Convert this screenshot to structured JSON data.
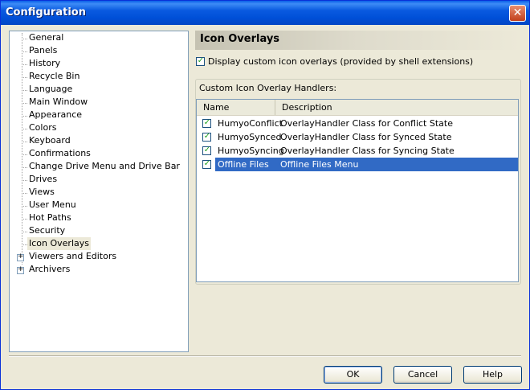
{
  "window": {
    "title": "Configuration"
  },
  "tree": {
    "items": [
      {
        "label": "General"
      },
      {
        "label": "Panels"
      },
      {
        "label": "History"
      },
      {
        "label": "Recycle Bin"
      },
      {
        "label": "Language"
      },
      {
        "label": "Main Window"
      },
      {
        "label": "Appearance"
      },
      {
        "label": "Colors"
      },
      {
        "label": "Keyboard"
      },
      {
        "label": "Confirmations"
      },
      {
        "label": "Change Drive Menu and Drive Bar"
      },
      {
        "label": "Drives"
      },
      {
        "label": "Views"
      },
      {
        "label": "User Menu"
      },
      {
        "label": "Hot Paths"
      },
      {
        "label": "Security"
      },
      {
        "label": "Icon Overlays",
        "selected": true
      },
      {
        "label": "Viewers and Editors",
        "expander": "+"
      },
      {
        "label": "Archivers",
        "expander": "+"
      }
    ]
  },
  "pane": {
    "title": "Icon Overlays",
    "display_checkbox_label": "Display custom icon overlays (provided by shell extensions)",
    "display_checked": true,
    "group_label": "Custom Icon Overlay Handlers:",
    "columns": {
      "name": "Name",
      "description": "Description"
    },
    "rows": [
      {
        "name": "HumyoConflict",
        "description": "OverlayHandler Class for Conflict State",
        "checked": true
      },
      {
        "name": "HumyoSynced",
        "description": "OverlayHandler Class for Synced State",
        "checked": true
      },
      {
        "name": "HumyoSyncing",
        "description": "OverlayHandler Class for Syncing State",
        "checked": true
      },
      {
        "name": "Offline Files",
        "description": "Offline Files Menu",
        "checked": true,
        "selected": true
      }
    ]
  },
  "buttons": {
    "ok": "OK",
    "cancel": "Cancel",
    "help": "Help"
  },
  "icons": {
    "close": "close-icon",
    "check": "checkmark-icon",
    "expand": "plus-icon"
  },
  "colors": {
    "title_bar": "#0a5ae0",
    "selection": "#316ac5",
    "check": "#21a121"
  }
}
